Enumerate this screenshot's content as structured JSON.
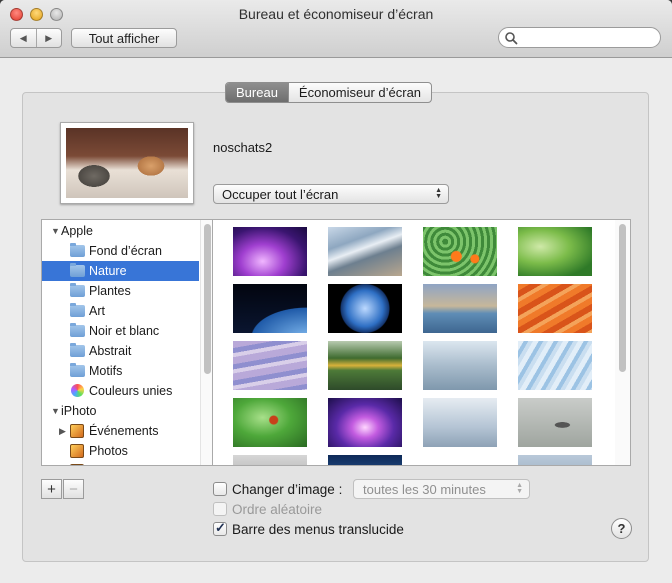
{
  "window": {
    "title": "Bureau et économiseur d’écran"
  },
  "toolbar": {
    "show_all_label": "Tout afficher",
    "search_placeholder": ""
  },
  "tabs": [
    {
      "label": "Bureau",
      "selected": true
    },
    {
      "label": "Économiseur d’écran",
      "selected": false
    }
  ],
  "preview": {
    "image_name": "noschats2",
    "fit_mode": "Occuper tout l’écran"
  },
  "sidebar": {
    "groups": [
      {
        "label": "Apple",
        "items": [
          {
            "label": "Fond d’écran",
            "icon": "folder-icon"
          },
          {
            "label": "Nature",
            "icon": "folder-icon",
            "selected": true
          },
          {
            "label": "Plantes",
            "icon": "folder-icon"
          },
          {
            "label": "Art",
            "icon": "folder-icon"
          },
          {
            "label": "Noir et blanc",
            "icon": "folder-icon"
          },
          {
            "label": "Abstrait",
            "icon": "folder-icon"
          },
          {
            "label": "Motifs",
            "icon": "folder-icon"
          },
          {
            "label": "Couleurs unies",
            "icon": "color-wheel-icon"
          }
        ]
      },
      {
        "label": "iPhoto",
        "items": [
          {
            "label": "Événements",
            "icon": "iphoto-events-icon"
          },
          {
            "label": "Photos",
            "icon": "iphoto-photos-icon"
          }
        ]
      }
    ]
  },
  "options": {
    "change_picture_label": "Changer d’image :",
    "change_picture_checked": false,
    "interval": "toutes les 30 minutes",
    "random_order_label": "Ordre aléatoire",
    "random_order_checked": false,
    "translucent_menu_label": "Barre des menus translucide",
    "translucent_menu_checked": true
  },
  "buttons": {
    "add": "+",
    "remove": "−",
    "help": "?"
  },
  "colors": {
    "selection": "#3875d7",
    "segment_active": "#7a7a7a"
  }
}
